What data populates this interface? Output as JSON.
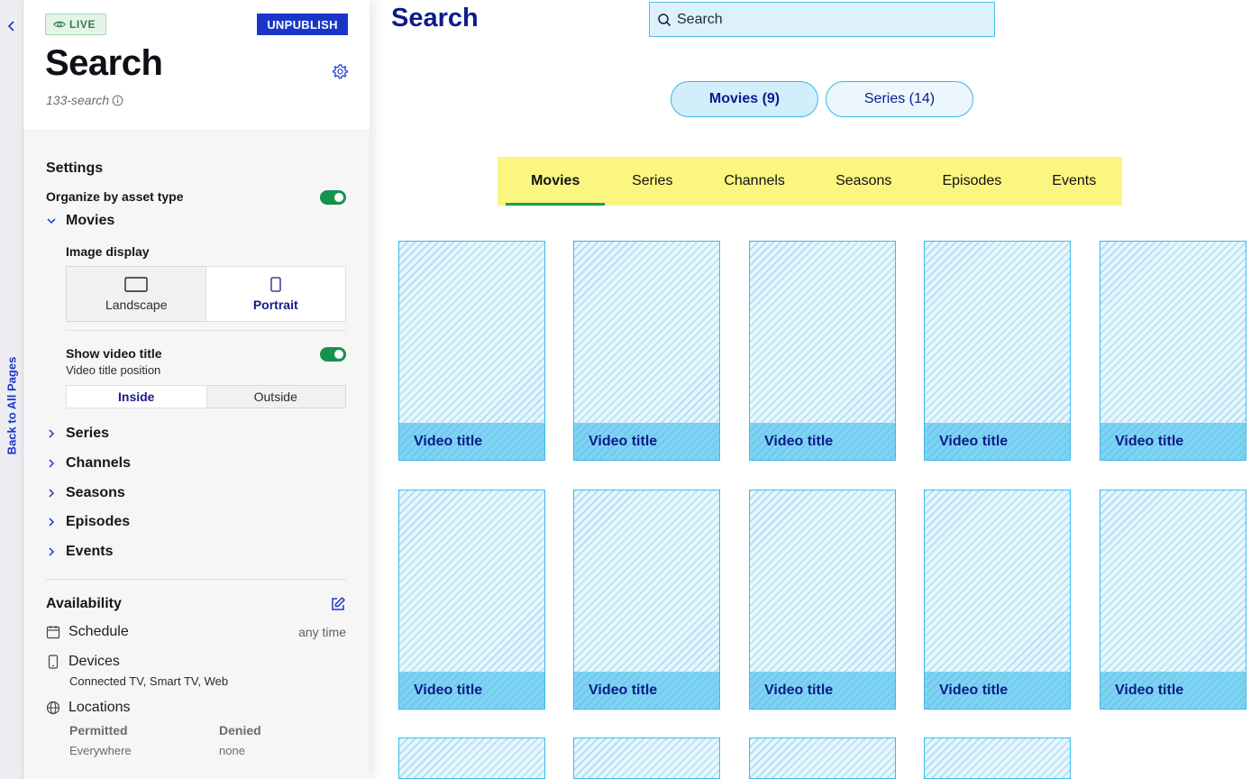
{
  "nav": {
    "back_label": "Back to All Pages"
  },
  "header": {
    "status": "LIVE",
    "unpublish_label": "UNPUBLISH",
    "title": "Search",
    "slug": "133-search"
  },
  "settings": {
    "heading": "Settings",
    "organize_label": "Organize by asset type",
    "organize_enabled": true,
    "sections": [
      "Movies",
      "Series",
      "Channels",
      "Seasons",
      "Episodes",
      "Events"
    ],
    "expanded_section": "Movies",
    "image_display": {
      "label": "Image display",
      "options": [
        "Landscape",
        "Portrait"
      ],
      "selected": "Portrait"
    },
    "show_video_title": {
      "label": "Show video title",
      "enabled": true,
      "position_label": "Video title position",
      "options": [
        "Inside",
        "Outside"
      ],
      "selected": "Inside"
    }
  },
  "availability": {
    "heading": "Availability",
    "schedule_label": "Schedule",
    "schedule_value": "any time",
    "devices_label": "Devices",
    "devices_value": "Connected TV, Smart TV, Web",
    "locations_label": "Locations",
    "permitted_label": "Permitted",
    "permitted_value": "Everywhere",
    "denied_label": "Denied",
    "denied_value": "none"
  },
  "preview": {
    "title": "Search",
    "search_placeholder": "Search",
    "pills": [
      {
        "label": "Movies (9)",
        "active": true
      },
      {
        "label": "Series (14)",
        "active": false
      }
    ],
    "tabs": [
      "Movies",
      "Series",
      "Channels",
      "Seasons",
      "Episodes",
      "Events"
    ],
    "active_tab": "Movies",
    "card_title": "Video title"
  },
  "colors": {
    "brand_blue": "#1a36c8",
    "navy": "#0d1c8a",
    "toggle_green": "#17924a",
    "tabbar_yellow": "#fbf67f",
    "card_cyan": "#3dbbe8"
  }
}
